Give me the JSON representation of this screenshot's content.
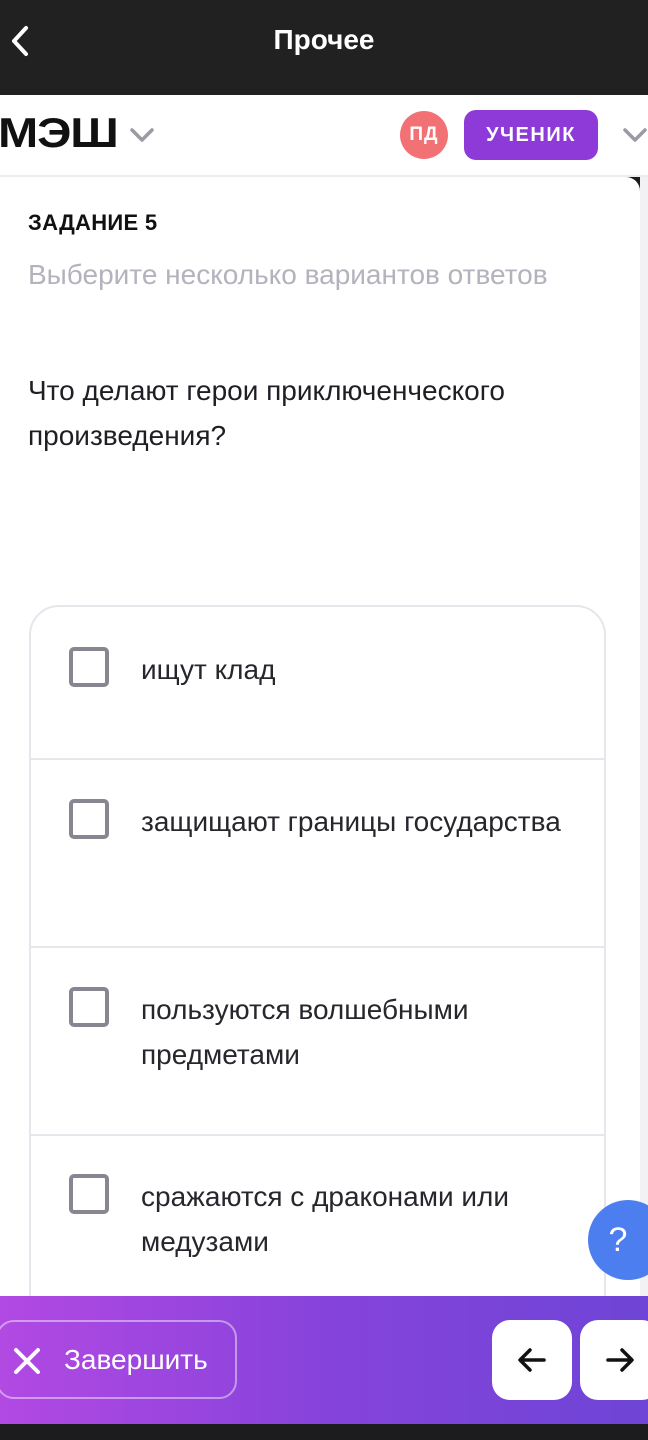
{
  "topbar": {
    "title": "Прочее",
    "back_icon": "chevron-left-icon"
  },
  "header": {
    "logo": "МЭШ",
    "avatar_initials": "ПД",
    "role_label": "УЧЕНИК",
    "colors": {
      "avatar": "#f27174",
      "role": "#8d3ad9"
    }
  },
  "task": {
    "number_label": "ЗАДАНИЕ 5",
    "hint": "Выберите несколько вариантов ответов",
    "question": "Что делают герои приключенческого произведения?",
    "answers": [
      {
        "text": "ищут клад",
        "checked": false
      },
      {
        "text": "защищают границы государства",
        "checked": false
      },
      {
        "text": "пользуются волшебными предметами",
        "checked": false
      },
      {
        "text": "сражаются с драконами или медузами",
        "checked": false
      }
    ]
  },
  "help": {
    "label": "?"
  },
  "bottombar": {
    "finish_label": "Завершить",
    "prev_icon": "arrow-left-icon",
    "next_icon": "arrow-right-icon",
    "gradient": [
      "#b249e3",
      "#6e45d6"
    ]
  }
}
